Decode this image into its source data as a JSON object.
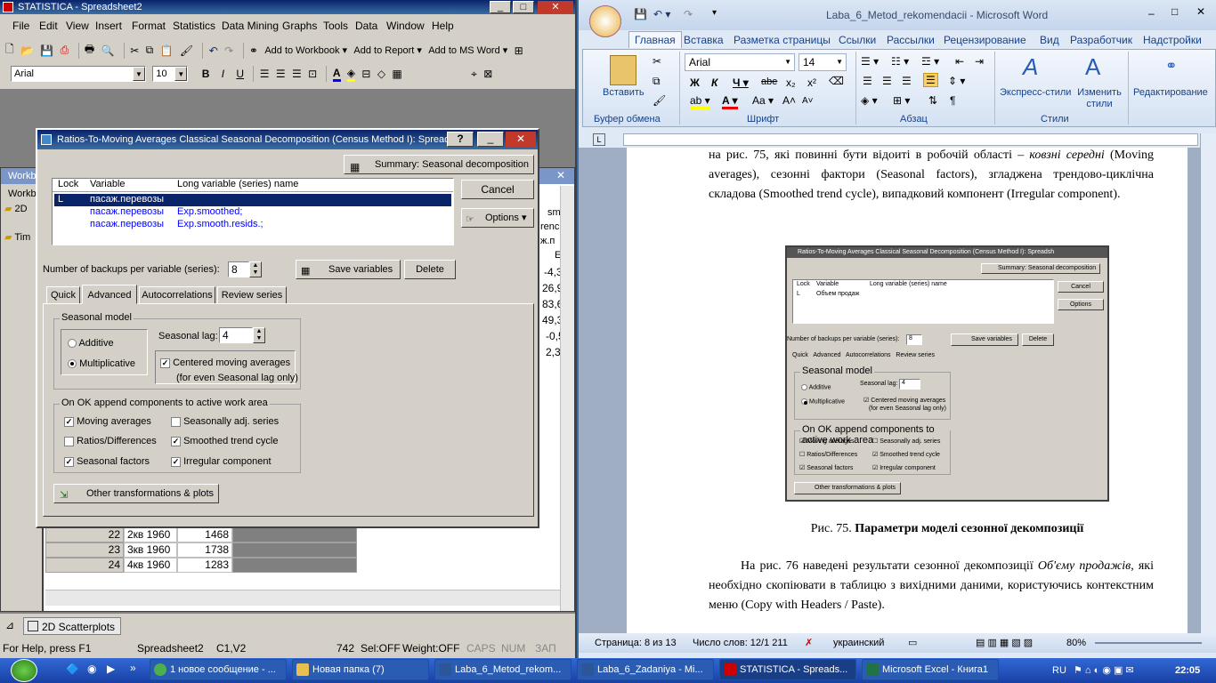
{
  "statistica": {
    "title": "STATISTICA - Spreadsheet2",
    "menu": [
      "File",
      "Edit",
      "View",
      "Insert",
      "Format",
      "Statistics",
      "Data Mining",
      "Graphs",
      "Tools",
      "Data",
      "Window",
      "Help"
    ],
    "toolbar": {
      "add_workbook": "Add to Workbook",
      "add_report": "Add to Report",
      "add_msword": "Add to MS Word"
    },
    "font_name": "Arial",
    "font_size": "10",
    "workbook_label": "Workbo",
    "tree": {
      "item1": "Workb",
      "item2": "2D",
      "item3": "Tim"
    },
    "sheet_cols": [
      "sm",
      "renc",
      "ж.п",
      "E"
    ],
    "sheet_vals": [
      "-4,3",
      "26,9",
      "83,6",
      "49,3",
      "-0,5",
      "2,3"
    ],
    "rows": [
      {
        "n": "22",
        "period": "2кв 1960",
        "val": "1468"
      },
      {
        "n": "23",
        "period": "3кв 1960",
        "val": "1738"
      },
      {
        "n": "24",
        "period": "4кв 1960",
        "val": "1283"
      }
    ],
    "scatter_tab": "2D Scatterplots",
    "status": {
      "help": "For Help, press F1",
      "sheet": "Spreadsheet2",
      "cell": "C1,V2",
      "num": "742",
      "sel": "Sel:OFF",
      "weight": "Weight:OFF",
      "caps": "CAPS",
      "numlock": "NUM",
      "zap": "ЗАП"
    }
  },
  "dialog": {
    "title": "Ratios-To-Moving Averages Classical Seasonal Decomposition (Census Method I): Spreadsh",
    "summary_btn": "Summary:  Seasonal decomposition",
    "cancel_btn": "Cancel",
    "options_btn": "Options",
    "list_headers": {
      "lock": "Lock",
      "variable": "Variable",
      "long": "Long variable (series) name"
    },
    "list_rows": [
      {
        "lock": "L",
        "variable": "пасаж.перевозы",
        "long": ""
      },
      {
        "lock": "",
        "variable": "пасаж.перевозы",
        "long": "Exp.smoothed;"
      },
      {
        "lock": "",
        "variable": "пасаж.перевозы",
        "long": "Exp.smooth.resids.;"
      }
    ],
    "backups_label": "Number of backups per variable (series):",
    "backups_value": "8",
    "save_btn": "Save variables",
    "delete_btn": "Delete",
    "tabs": [
      "Quick",
      "Advanced",
      "Autocorrelations",
      "Review series"
    ],
    "seasonal_model": {
      "legend": "Seasonal model",
      "additive": "Additive",
      "multiplicative": "Multiplicative",
      "lag_label": "Seasonal lag:",
      "lag_value": "4",
      "centered": "Centered moving averages",
      "centered_note": "(for even Seasonal lag only)"
    },
    "append": {
      "legend": "On OK append components to active work area",
      "moving": "Moving averages",
      "seasadj": "Seasonally adj. series",
      "ratios": "Ratios/Differences",
      "smoothed": "Smoothed trend cycle",
      "factors": "Seasonal factors",
      "irregular": "Irregular component"
    },
    "other_btn": "Other transformations & plots"
  },
  "word": {
    "title": "Laba_6_Metod_rekomendacii - Microsoft Word",
    "tabs": [
      "Главная",
      "Вставка",
      "Разметка страницы",
      "Ссылки",
      "Рассылки",
      "Рецензирование",
      "Вид",
      "Разработчик",
      "Надстройки"
    ],
    "groups": {
      "clipboard": "Буфер обмена",
      "font": "Шрифт",
      "paragraph": "Абзац",
      "styles": "Стили"
    },
    "paste_label": "Вставить",
    "font_name": "Arial",
    "font_size": "14",
    "express_styles": "Экспресс-стили",
    "change_styles": "Изменить стили",
    "editing": "Редактирование",
    "para1_a": "на рис. 75, які повинні бути відоиті в робочій області –",
    "para1_b": "ковзні середні",
    "para1_c": "(Moving averages), сезонні фактори (Seasonal factors), згладжена трендово-циклічна складова (Smoothed trend cycle), випадковий компонент (Irregular component).",
    "figure_caption_pre": "Рис. 75.",
    "figure_caption": "Параметри моделі сезонної декомпозиції",
    "para2_a": "На рис. 76 наведені результати сезонної декомпозиції",
    "para2_b": "Об'єму продажів",
    "para2_c": ", які необхідно скопіювати в таблицю з вихідними даними, користуючись контекстним меню (Copy with Headers / Paste).",
    "fig": {
      "summary": "Summary:  Seasonal decomposition",
      "row_var": "Объем продаж"
    },
    "status": {
      "page": "Страница: 8 из 13",
      "words": "Число слов: 12/1 211",
      "lang": "украинский",
      "zoom": "80%"
    }
  },
  "taskbar": {
    "items": [
      "1 новое сообщение - ...",
      "Новая папка (7)",
      "Laba_6_Metod_rekom...",
      "Laba_6_Zadaniya - Mi...",
      "STATISTICA - Spreads...",
      "Microsoft Excel - Книга1"
    ],
    "lang": "RU",
    "clock": "22:05"
  }
}
